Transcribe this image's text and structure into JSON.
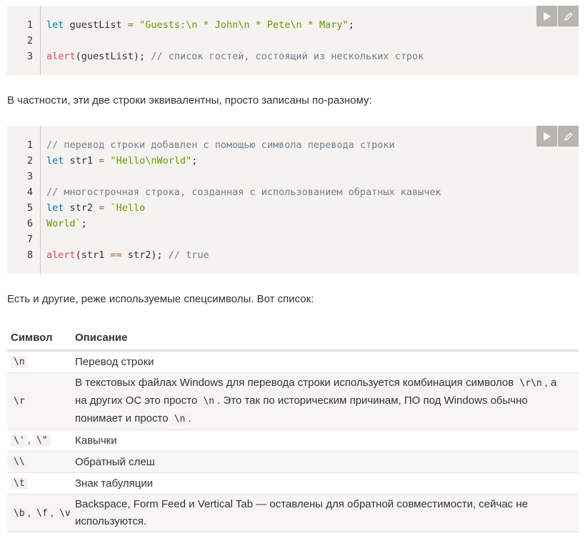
{
  "code_block_1": {
    "lines": [
      {
        "num": "1",
        "tokens": [
          [
            "kw",
            "let"
          ],
          [
            "",
            "&nbsp;guestList&nbsp;"
          ],
          [
            "op",
            "="
          ],
          [
            "",
            "&nbsp;"
          ],
          [
            "str",
            "\"Guests:\\n * John\\n * Pete\\n * Mary\""
          ],
          [
            "",
            ";"
          ]
        ]
      },
      {
        "num": "2",
        "tokens": []
      },
      {
        "num": "3",
        "tokens": [
          [
            "fn",
            "alert"
          ],
          [
            "",
            "(guestList);&nbsp;"
          ],
          [
            "cm",
            "// список гостей, состоящий из нескольких строк"
          ]
        ]
      }
    ]
  },
  "paragraph_1": "В частности, эти две строки эквивалентны, просто записаны по-разному:",
  "code_block_2": {
    "lines": [
      {
        "num": "1",
        "tokens": [
          [
            "cm",
            "// перевод строки добавлен с помощью символа перевода строки"
          ]
        ]
      },
      {
        "num": "2",
        "tokens": [
          [
            "kw",
            "let"
          ],
          [
            "",
            "&nbsp;str1&nbsp;"
          ],
          [
            "op",
            "="
          ],
          [
            "",
            "&nbsp;"
          ],
          [
            "str",
            "\"Hello\\nWorld\""
          ],
          [
            "",
            ";"
          ]
        ]
      },
      {
        "num": "3",
        "tokens": []
      },
      {
        "num": "4",
        "tokens": [
          [
            "cm",
            "// многострочная строка, созданная с использованием обратных кавычек"
          ]
        ]
      },
      {
        "num": "5",
        "tokens": [
          [
            "kw",
            "let"
          ],
          [
            "",
            "&nbsp;str2&nbsp;"
          ],
          [
            "op",
            "="
          ],
          [
            "",
            "&nbsp;"
          ],
          [
            "str",
            "`Hello"
          ]
        ]
      },
      {
        "num": "6",
        "tokens": [
          [
            "str",
            "World`"
          ],
          [
            "",
            ";"
          ]
        ]
      },
      {
        "num": "7",
        "tokens": []
      },
      {
        "num": "8",
        "tokens": [
          [
            "fn",
            "alert"
          ],
          [
            "",
            "(str1&nbsp;"
          ],
          [
            "op",
            "=="
          ],
          [
            "",
            "&nbsp;str2);&nbsp;"
          ],
          [
            "cm",
            "// true"
          ]
        ]
      }
    ]
  },
  "paragraph_2": "Есть и другие, реже используемые спецсимволы. Вот список:",
  "table": {
    "headers": [
      "Символ",
      "Описание"
    ],
    "rows": [
      {
        "symbols": [
          "\\n"
        ],
        "desc": [
          [
            "t",
            "Перевод строки"
          ]
        ]
      },
      {
        "symbols": [
          "\\r"
        ],
        "desc": [
          [
            "t",
            "В текстовых файлах Windows для перевода строки используется комбинация символов "
          ],
          [
            "c",
            "\\r\\n"
          ],
          [
            "t",
            ", а на других ОС это просто "
          ],
          [
            "c",
            "\\n"
          ],
          [
            "t",
            ". Это так по историческим причинам, ПО под Windows обычно понимает и просто "
          ],
          [
            "c",
            "\\n"
          ],
          [
            "t",
            "."
          ]
        ]
      },
      {
        "symbols": [
          "\\'",
          "\\\""
        ],
        "desc": [
          [
            "t",
            "Кавычки"
          ]
        ]
      },
      {
        "symbols": [
          "\\\\"
        ],
        "desc": [
          [
            "t",
            "Обратный слеш"
          ]
        ]
      },
      {
        "symbols": [
          "\\t"
        ],
        "desc": [
          [
            "t",
            "Знак табуляции"
          ]
        ]
      },
      {
        "symbols": [
          "\\b",
          "\\f",
          "\\v"
        ],
        "desc": [
          [
            "t",
            "Backspace, Form Feed и Vertical Tab — оставлены для обратной совместимости, сейчас не используются."
          ]
        ]
      }
    ]
  },
  "icons": {
    "run": "play-icon",
    "edit": "pencil-icon"
  }
}
